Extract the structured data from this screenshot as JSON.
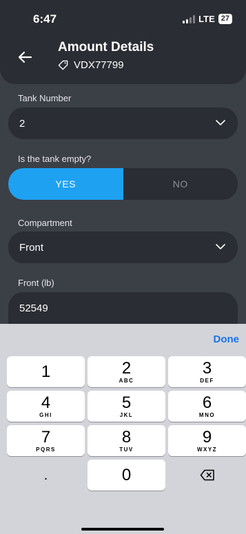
{
  "status": {
    "time": "6:47",
    "network": "LTE",
    "battery": "27"
  },
  "header": {
    "title": "Amount Details",
    "tag_id": "VDX77799"
  },
  "form": {
    "tank_number": {
      "label": "Tank Number",
      "value": "2"
    },
    "tank_empty": {
      "label": "Is the tank empty?",
      "yes": "YES",
      "no": "NO",
      "selected": "YES"
    },
    "compartment": {
      "label": "Compartment",
      "value": "Front"
    },
    "front_lb": {
      "label": "Front (lb)",
      "value": "52549"
    }
  },
  "keyboard": {
    "done_label": "Done",
    "keys": [
      {
        "num": "1",
        "letters": ""
      },
      {
        "num": "2",
        "letters": "ABC"
      },
      {
        "num": "3",
        "letters": "DEF"
      },
      {
        "num": "4",
        "letters": "GHI"
      },
      {
        "num": "5",
        "letters": "JKL"
      },
      {
        "num": "6",
        "letters": "MNO"
      },
      {
        "num": "7",
        "letters": "PQRS"
      },
      {
        "num": "8",
        "letters": "TUV"
      },
      {
        "num": "9",
        "letters": "WXYZ"
      },
      {
        "num": ".",
        "letters": ""
      },
      {
        "num": "0",
        "letters": ""
      }
    ]
  },
  "colors": {
    "accent": "#1ea1f1",
    "background": "#3b3f46",
    "field": "#2a2d33",
    "done": "#1a73e8"
  }
}
